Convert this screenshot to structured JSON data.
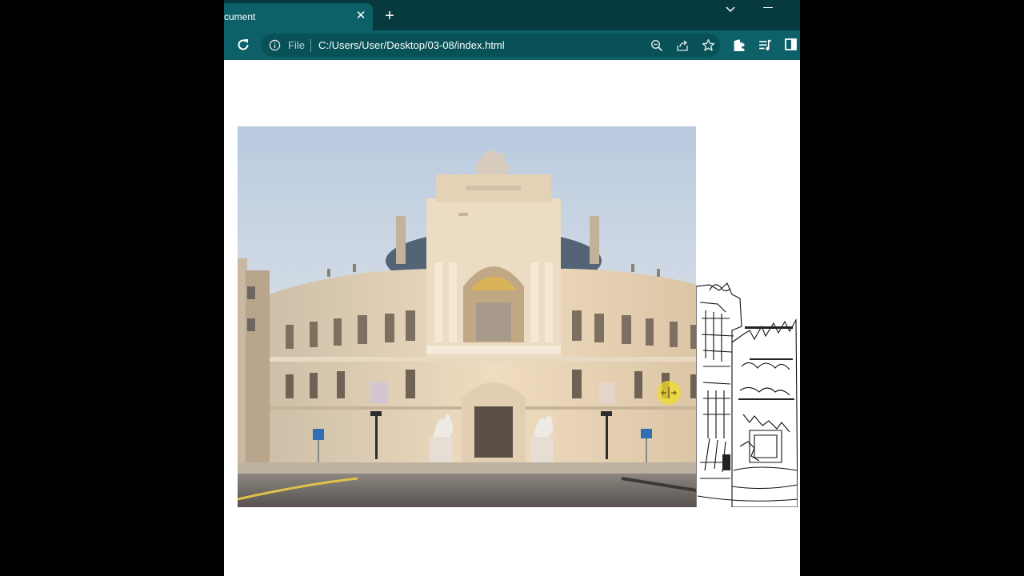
{
  "browser": {
    "tab": {
      "title": "cument",
      "close_glyph": "✕",
      "new_tab_glyph": "+"
    },
    "toolbar": {
      "scheme_label": "File",
      "url": "C:/Users/User/Desktop/03-08/index.html"
    },
    "icons": [
      "reload-icon",
      "info-icon",
      "zoom-icon",
      "share-icon",
      "star-icon",
      "extensions-icon",
      "media-controls-icon",
      "side-panel-icon",
      "tab-search-icon"
    ],
    "colors": {
      "titlebar": "#063a3f",
      "toolbar": "#0d6068",
      "omnibox": "#075157"
    }
  },
  "page": {
    "comparison_slider": {
      "before_image": "colour photograph of an ornate opera house",
      "after_image": "black-and-white line sketch of the same building",
      "split_fraction": 0.818,
      "handle_icon": "left-right-arrows-icon",
      "handle_color": "#f0dc28"
    }
  }
}
